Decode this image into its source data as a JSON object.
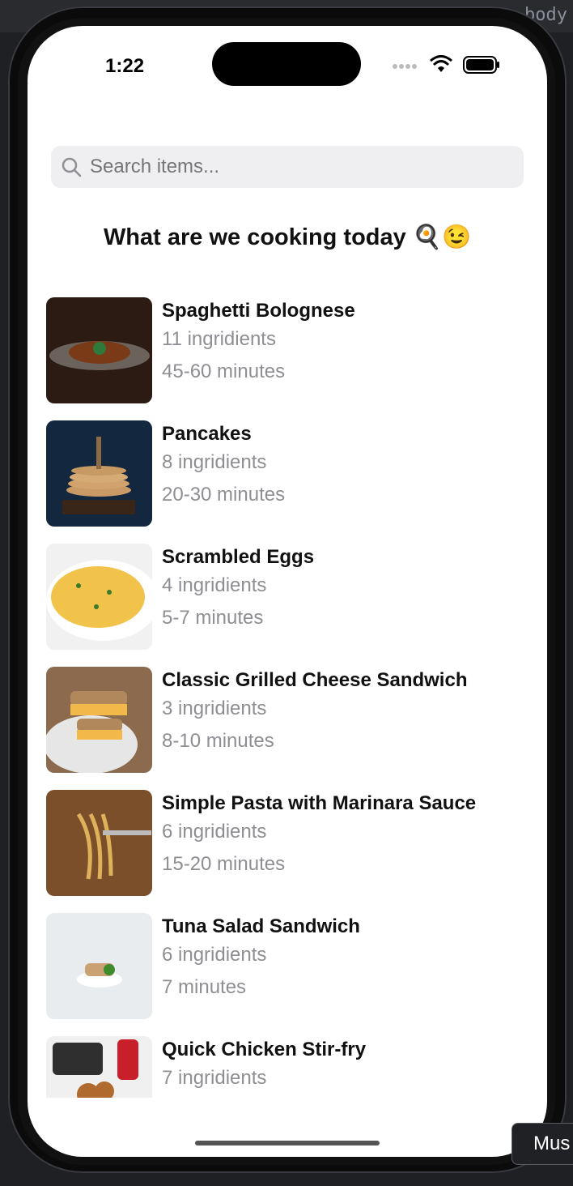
{
  "status_bar": {
    "time": "1:22"
  },
  "search": {
    "placeholder": "Search items..."
  },
  "headline": "What are we cooking today 🍳😉",
  "recipes": [
    {
      "name": "Spaghetti Bolognese",
      "ingredients": "11 ingridients",
      "time": "45-60 minutes"
    },
    {
      "name": "Pancakes",
      "ingredients": "8 ingridients",
      "time": "20-30 minutes"
    },
    {
      "name": "Scrambled Eggs",
      "ingredients": "4 ingridients",
      "time": "5-7 minutes"
    },
    {
      "name": "Classic Grilled Cheese Sandwich",
      "ingredients": "3 ingridients",
      "time": " 8-10 minutes"
    },
    {
      "name": "Simple Pasta with Marinara Sauce",
      "ingredients": "6 ingridients",
      "time": "15-20 minutes"
    },
    {
      "name": "Tuna Salad Sandwich",
      "ingredients": "6 ingridients",
      "time": "7 minutes"
    },
    {
      "name": "Quick Chicken Stir-fry",
      "ingredients": "7 ingridients",
      "time": ""
    }
  ],
  "ide": {
    "tab_label": "body",
    "tooltip_label": "Mus"
  },
  "icons": {
    "search": "search-icon",
    "signal": "signal-icon",
    "wifi": "wifi-icon",
    "battery": "battery-icon"
  },
  "colors": {
    "background": "#ffffff",
    "search_bg": "#efeff1",
    "secondary_text": "#8e8e93",
    "primary_text": "#111111"
  }
}
